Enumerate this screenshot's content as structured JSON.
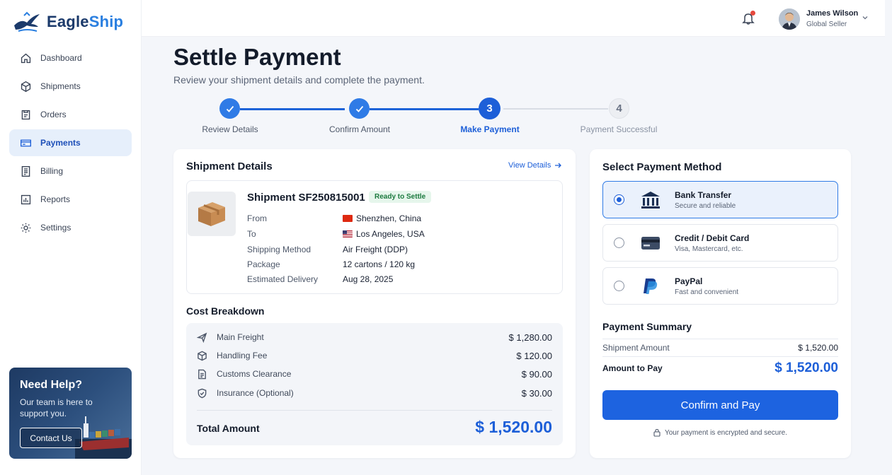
{
  "brand": {
    "name_part1": "Eagle",
    "name_part2": "Ship"
  },
  "nav": [
    {
      "label": "Dashboard",
      "icon": "home-icon"
    },
    {
      "label": "Shipments",
      "icon": "box-icon"
    },
    {
      "label": "Orders",
      "icon": "orders-icon"
    },
    {
      "label": "Payments",
      "icon": "card-icon",
      "active": true
    },
    {
      "label": "Billing",
      "icon": "billing-icon"
    },
    {
      "label": "Reports",
      "icon": "reports-icon"
    },
    {
      "label": "Settings",
      "icon": "gear-icon"
    }
  ],
  "help": {
    "title": "Need Help?",
    "text": "Our team is here to support you.",
    "button": "Contact Us"
  },
  "user": {
    "name": "James Wilson",
    "role": "Global Seller"
  },
  "page": {
    "title": "Settle Payment",
    "subtitle": "Review your shipment details and complete the payment."
  },
  "steps": [
    {
      "number": "1",
      "label": "Review Details",
      "state": "done"
    },
    {
      "number": "2",
      "label": "Confirm Amount",
      "state": "done"
    },
    {
      "number": "3",
      "label": "Make Payment",
      "state": "active"
    },
    {
      "number": "4",
      "label": "Payment Successful",
      "state": "pending"
    }
  ],
  "shipment": {
    "heading": "Shipment Details",
    "view_link": "View Details",
    "id": "Shipment SF250815001",
    "status": "Ready to Settle",
    "fields": [
      {
        "label": "From",
        "value": "Shenzhen, China",
        "flag": "cn"
      },
      {
        "label": "To",
        "value": "Los Angeles, USA",
        "flag": "us"
      },
      {
        "label": "Shipping Method",
        "value": "Air Freight (DDP)"
      },
      {
        "label": "Package",
        "value": "12 cartons / 120 kg"
      },
      {
        "label": "Estimated Delivery",
        "value": "Aug 28, 2025"
      }
    ]
  },
  "costs": {
    "heading": "Cost Breakdown",
    "items": [
      {
        "label": "Main Freight",
        "amount": "$ 1,280.00",
        "icon": "plane-icon"
      },
      {
        "label": "Handling Fee",
        "amount": "$ 120.00",
        "icon": "box-icon"
      },
      {
        "label": "Customs Clearance",
        "amount": "$ 90.00",
        "icon": "document-icon"
      },
      {
        "label": "Insurance (Optional)",
        "amount": "$ 30.00",
        "icon": "shield-icon"
      }
    ],
    "total_label": "Total Amount",
    "total_amount": "$ 1,520.00"
  },
  "payment": {
    "heading": "Select Payment Method",
    "methods": [
      {
        "name": "Bank Transfer",
        "desc": "Secure and reliable",
        "icon": "bank-icon",
        "selected": true
      },
      {
        "name": "Credit / Debit Card",
        "desc": "Visa, Mastercard, etc.",
        "icon": "credit-card-icon",
        "selected": false
      },
      {
        "name": "PayPal",
        "desc": "Fast and convenient",
        "icon": "paypal-icon",
        "selected": false
      }
    ],
    "summary_heading": "Payment Summary",
    "shipment_amount_label": "Shipment Amount",
    "shipment_amount": "$ 1,520.00",
    "amount_to_pay_label": "Amount to Pay",
    "amount_to_pay": "$ 1,520.00",
    "button": "Confirm and Pay",
    "secure_note": "Your payment is encrypted and secure."
  },
  "colors": {
    "accent": "#1d5fd8",
    "success_badge": "#1c7a3f",
    "sidebar_active_bg": "#e6effb"
  }
}
